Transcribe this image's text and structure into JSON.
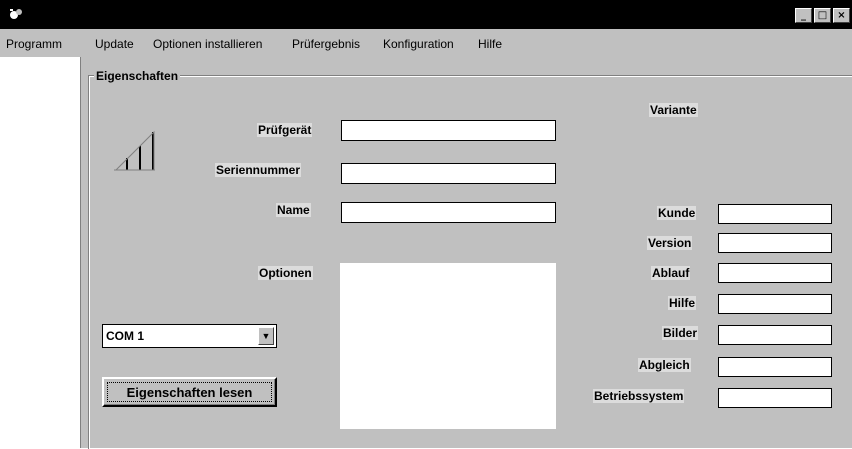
{
  "window": {
    "minimize": "_",
    "maximize": "□",
    "close": "×"
  },
  "menu": [
    {
      "label": "Programm",
      "underline": "P"
    },
    {
      "label": "Update",
      "underline": "U"
    },
    {
      "label": "Optionen installieren",
      "underline": "O"
    },
    {
      "label": "Prüfergebnis",
      "underline": ""
    },
    {
      "label": "Konfiguration",
      "underline": ""
    },
    {
      "label": "Hilfe",
      "underline": "H"
    }
  ],
  "group": {
    "title": "Eigenschaften"
  },
  "labels": {
    "pruefgeraet": "Prüfgerät",
    "seriennummer": "Seriennummer",
    "name": "Name",
    "optionen": "Optionen",
    "variante": "Variante",
    "kunde": "Kunde",
    "version": "Version",
    "ablauf": "Ablauf",
    "hilfe": "Hilfe",
    "bilder": "Bilder",
    "abgleich": "Abgleich",
    "betriebssystem": "Betriebssystem"
  },
  "fields": {
    "pruefgeraet": "",
    "seriennummer": "",
    "name": "",
    "kunde": "",
    "version": "",
    "ablauf": "",
    "hilfe": "",
    "bilder": "",
    "abgleich": "",
    "betriebssystem": ""
  },
  "com_port": {
    "selected": "COM 1"
  },
  "buttons": {
    "read_properties": "Eigenschaften lesen"
  },
  "icons": {
    "app": "app-icon",
    "signal": "signal-bars-icon",
    "dropdown": "chevron-down-icon"
  }
}
